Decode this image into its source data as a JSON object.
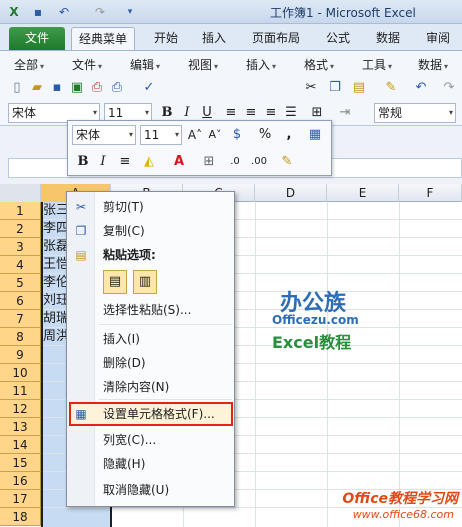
{
  "window": {
    "title": "工作簿1 - Microsoft Excel"
  },
  "ribbon": {
    "tabs": [
      "文件",
      "经典菜单",
      "开始",
      "插入",
      "页面布局",
      "公式",
      "数据",
      "审阅"
    ],
    "menus": [
      "全部",
      "文件",
      "编辑",
      "视图",
      "插入",
      "格式",
      "工具",
      "数据"
    ]
  },
  "toolbar": {
    "font_name": "宋体",
    "font_size": "11",
    "number_format": "常规"
  },
  "minibar": {
    "font_name": "宋体",
    "font_size": "11"
  },
  "grid": {
    "columns": [
      "A",
      "B",
      "C",
      "D",
      "E",
      "F"
    ],
    "rows": [
      "1",
      "2",
      "3",
      "4",
      "5",
      "6",
      "7",
      "8",
      "9",
      "10",
      "11",
      "12",
      "13",
      "14",
      "15",
      "16",
      "17",
      "18"
    ],
    "col_a_values": [
      "张三",
      "李四",
      "张磊",
      "王恺",
      "李伦",
      "刘珏",
      "胡瑞",
      "周洪"
    ]
  },
  "context_menu": {
    "cut": "剪切(T)",
    "copy": "复制(C)",
    "paste_options": "粘贴选项:",
    "paste_special": "选择性粘贴(S)...",
    "insert": "插入(I)",
    "delete": "删除(D)",
    "clear_contents": "清除内容(N)",
    "format_cells": "设置单元格格式(F)...",
    "column_width": "列宽(C)...",
    "hide": "隐藏(H)",
    "unhide": "取消隐藏(U)"
  },
  "watermark": {
    "logo_cn": "办公族",
    "logo_url": "Officezu.com",
    "logo_sub": "Excel教程",
    "footer_title": "Office教程学习网",
    "footer_url": "www.office68.com"
  },
  "colors": {
    "file_tab": "#1f7a2c",
    "selection": "#c7dcf2",
    "row_header_selected": "#ffd58a",
    "highlight_border": "#e2231a"
  }
}
